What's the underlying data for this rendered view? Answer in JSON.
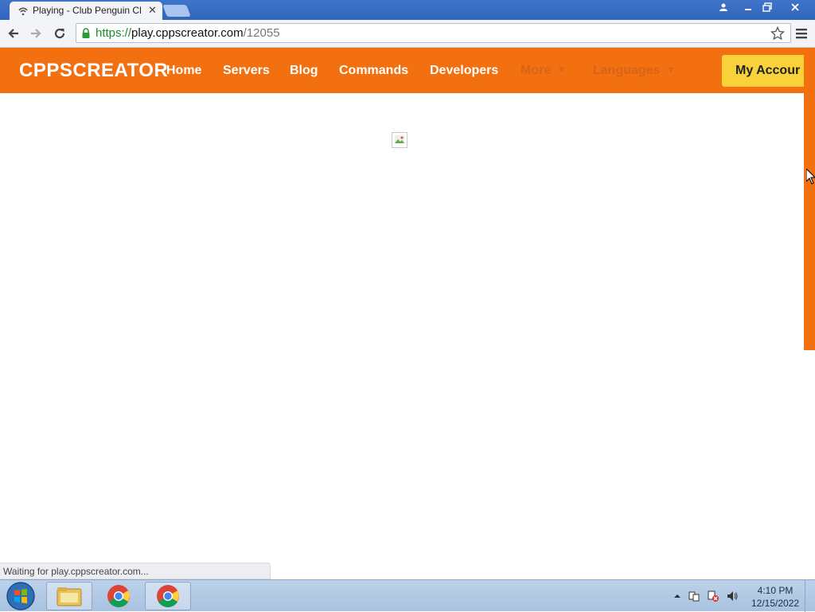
{
  "browser": {
    "tab_title": "Playing - Club Penguin Cl",
    "tab_close": "✕",
    "url_protocol": "https://",
    "url_host": "play.cppscreator.com",
    "url_path": "/12055"
  },
  "site": {
    "logo": "CPPSCREATOR",
    "nav": {
      "home": "Home",
      "servers": "Servers",
      "blog": "Blog",
      "commands": "Commands",
      "developers": "Developers",
      "more": "More",
      "languages": "Languages"
    },
    "account_button": "My Accour",
    "accent_color": "#f2700f",
    "account_color": "#f9d23a"
  },
  "status_bar": {
    "text": "Waiting for play.cppscreator.com..."
  },
  "taskbar": {
    "time": "4:10 PM",
    "date": "12/15/2022"
  }
}
